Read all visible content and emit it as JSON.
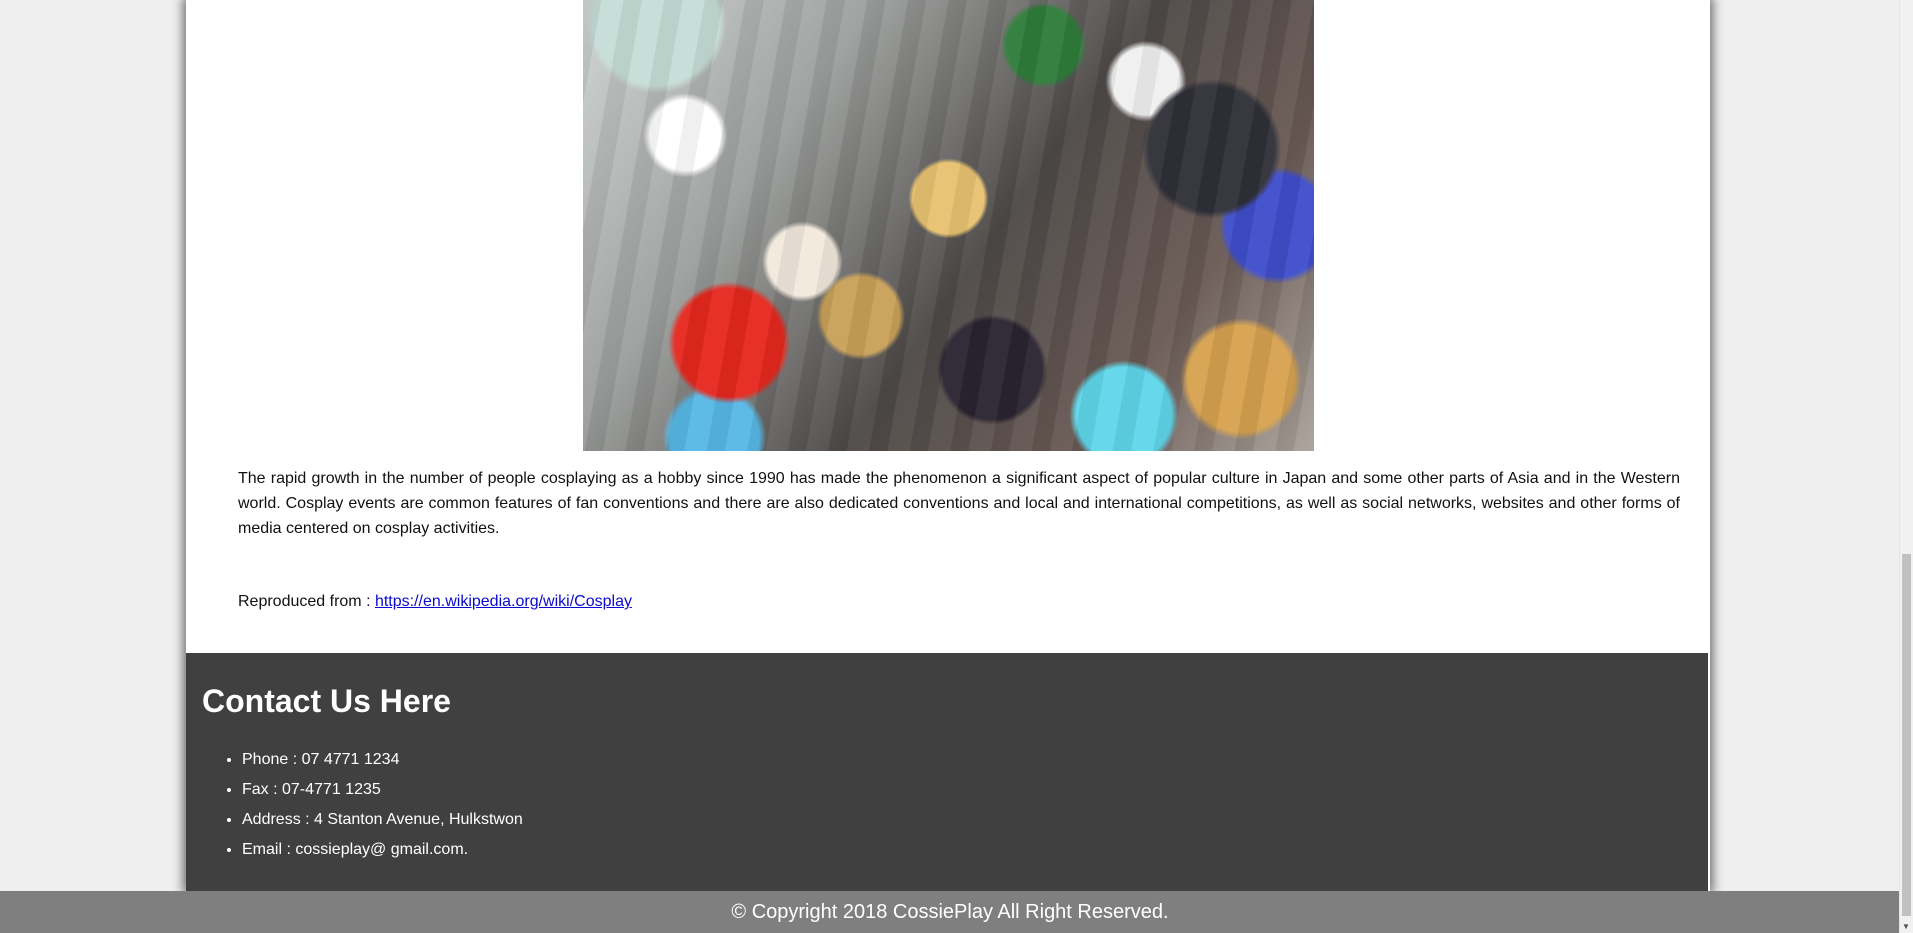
{
  "article": {
    "image_alt": "Crowd of cosplayers",
    "paragraph": "The rapid growth in the number of people cosplaying as a hobby since 1990 has made the phenomenon a significant aspect of popular culture in Japan and some other parts of Asia and in the Western world. Cosplay events are common features of fan conventions and there are also dedicated conventions and local and international competitions, as well as social networks, websites and other forms of media centered on cosplay activities.",
    "reproduced_prefix": "Reproduced from : ",
    "reproduced_link": "https://en.wikipedia.org/wiki/Cosplay"
  },
  "contact": {
    "heading": "Contact Us Here",
    "items": [
      "Phone : 07 4771 1234",
      "Fax : 07-4771 1235",
      "Address : 4 Stanton Avenue, Hulkstwon",
      "Email : cossieplay@ gmail.com."
    ]
  },
  "footer": {
    "copyright": "© Copyright 2018 CossiePlay All Right Reserved."
  },
  "colors": {
    "footer_bg": "#404040",
    "copyright_bg": "#7f7f7f",
    "link": "#0b0bd0"
  }
}
